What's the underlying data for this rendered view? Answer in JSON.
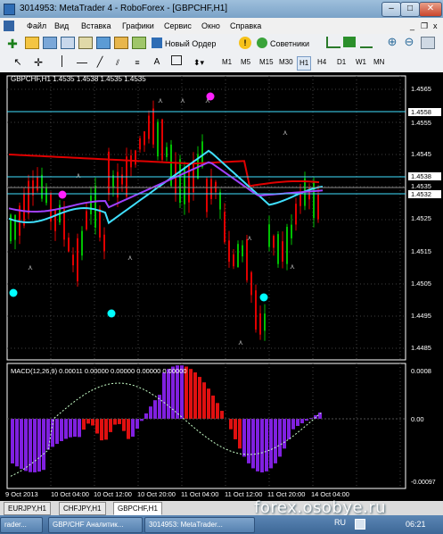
{
  "window": {
    "title": "3014953: MetaTrader 4 - RoboForex - [GBPCHF,H1]",
    "minimize": "–",
    "maximize": "□",
    "close": "✕"
  },
  "menu": {
    "items": [
      "Файл",
      "Вид",
      "Вставка",
      "Графики",
      "Сервис",
      "Окно",
      "Справка"
    ],
    "mdi_min": "_",
    "mdi_restore": "❐",
    "mdi_close": "x"
  },
  "toolbar": {
    "new_order": "Новый Ордер",
    "experts": "Советники"
  },
  "timeframes": [
    "M1",
    "M5",
    "M15",
    "M30",
    "H1",
    "H4",
    "D1",
    "W1",
    "MN"
  ],
  "timeframe_selected": "H1",
  "chart": {
    "header": "GBPCHF,H1  1.4535 1.4538 1.4535 1.4535",
    "price_axis": [
      "1.4565",
      "1.4555",
      "1.4545",
      "1.4525",
      "1.4515",
      "1.4505",
      "1.4495",
      "1.4485"
    ],
    "price_tags": [
      "1.4558",
      "1.4538",
      "1.4535",
      "1.4532"
    ],
    "macd_label": "MACD(12,26,9) 0.00011 0.00000 0.00000 0.00000 0.00000",
    "macd_axis": [
      "0.0008",
      "0.00",
      "-0.00097"
    ],
    "time_axis": [
      "9 Oct 2013",
      "10 Oct 04:00",
      "10 Oct 12:00",
      "10 Oct 20:00",
      "11 Oct 04:00",
      "11 Oct 12:00",
      "11 Oct 20:00",
      "14 Oct 04:00"
    ]
  },
  "tabs": [
    "EURJPY,H1",
    "CHFJPY,H1",
    "GBPCHF,H1"
  ],
  "active_tab": "GBPCHF,H1",
  "taskbar": {
    "items": [
      "rader...",
      "GBP/CHF  Аналитик...",
      "3014953: MetaTrader..."
    ],
    "lang": "RU",
    "time": "06:21"
  },
  "watermark": "forex.osobye.ru",
  "colors": {
    "bull": "#00c000",
    "bear": "#e00000",
    "ma_red": "#e00000",
    "ma_cyan": "#40e0ff",
    "ma_violet": "#a040ff",
    "macd_pos": "#8020e0",
    "macd_neg": "#e01010"
  }
}
